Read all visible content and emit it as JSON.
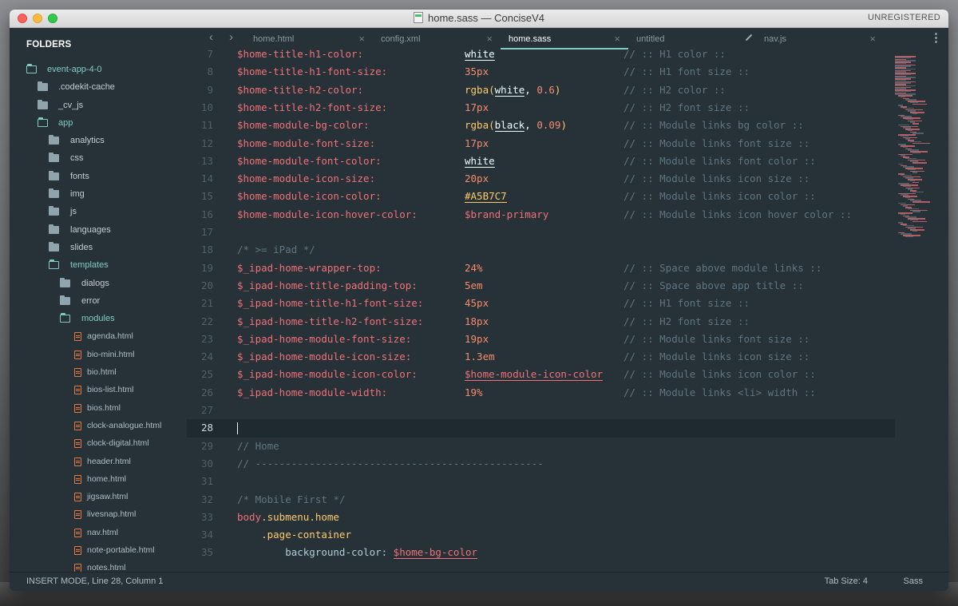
{
  "window": {
    "title": "home.sass — ConciseV4",
    "registration": "UNREGISTERED"
  },
  "sidebar": {
    "header": "FOLDERS",
    "items": [
      {
        "label": "event-app-4-0",
        "type": "folder",
        "open": true,
        "depth": 0
      },
      {
        "label": ".codekit-cache",
        "type": "folder",
        "open": false,
        "depth": 1
      },
      {
        "label": "_cv_js",
        "type": "folder",
        "open": false,
        "depth": 1
      },
      {
        "label": "app",
        "type": "folder",
        "open": true,
        "depth": 1
      },
      {
        "label": "analytics",
        "type": "folder",
        "open": false,
        "depth": 2
      },
      {
        "label": "css",
        "type": "folder",
        "open": false,
        "depth": 2
      },
      {
        "label": "fonts",
        "type": "folder",
        "open": false,
        "depth": 2
      },
      {
        "label": "img",
        "type": "folder",
        "open": false,
        "depth": 2
      },
      {
        "label": "js",
        "type": "folder",
        "open": false,
        "depth": 2
      },
      {
        "label": "languages",
        "type": "folder",
        "open": false,
        "depth": 2
      },
      {
        "label": "slides",
        "type": "folder",
        "open": false,
        "depth": 2
      },
      {
        "label": "templates",
        "type": "folder",
        "open": true,
        "depth": 2
      },
      {
        "label": "dialogs",
        "type": "folder",
        "open": false,
        "depth": 3
      },
      {
        "label": "error",
        "type": "folder",
        "open": false,
        "depth": 3
      },
      {
        "label": "modules",
        "type": "folder",
        "open": true,
        "depth": 3
      },
      {
        "label": "agenda.html",
        "type": "file",
        "depth": 4
      },
      {
        "label": "bio-mini.html",
        "type": "file",
        "depth": 4
      },
      {
        "label": "bio.html",
        "type": "file",
        "depth": 4
      },
      {
        "label": "bios-list.html",
        "type": "file",
        "depth": 4
      },
      {
        "label": "bios.html",
        "type": "file",
        "depth": 4
      },
      {
        "label": "clock-analogue.html",
        "type": "file",
        "depth": 4
      },
      {
        "label": "clock-digital.html",
        "type": "file",
        "depth": 4
      },
      {
        "label": "header.html",
        "type": "file",
        "depth": 4
      },
      {
        "label": "home.html",
        "type": "file",
        "depth": 4
      },
      {
        "label": "jigsaw.html",
        "type": "file",
        "depth": 4
      },
      {
        "label": "livesnap.html",
        "type": "file",
        "depth": 4
      },
      {
        "label": "nav.html",
        "type": "file",
        "depth": 4
      },
      {
        "label": "note-portable.html",
        "type": "file",
        "depth": 4
      },
      {
        "label": "notes.html",
        "type": "file",
        "depth": 4
      }
    ]
  },
  "tabs": [
    {
      "label": "home.html",
      "active": false,
      "close": "×"
    },
    {
      "label": "config.xml",
      "active": false,
      "close": "×"
    },
    {
      "label": "home.sass",
      "active": true,
      "close": "×"
    },
    {
      "label": "untitled",
      "active": false,
      "modified": true
    },
    {
      "label": "nav.js",
      "active": false,
      "close": "×"
    }
  ],
  "editor": {
    "lines": [
      {
        "n": "7",
        "code": "$home-title-h1-color:",
        "val": "white",
        "vt": "white",
        "cmt": "// :: H1 color ::"
      },
      {
        "n": "8",
        "code": "$home-title-h1-font-size:",
        "val": "35px",
        "vt": "num",
        "cmt": "// :: H1 font size ::"
      },
      {
        "n": "9",
        "code": "$home-title-h2-color:",
        "val": "rgba(white, 0.6)",
        "vt": "rgba",
        "rgbaArg": "white",
        "rgbaNum": "0.6",
        "cmt": "// :: H2 color ::"
      },
      {
        "n": "10",
        "code": "$home-title-h2-font-size:",
        "val": "17px",
        "vt": "num",
        "cmt": "// :: H2 font size ::"
      },
      {
        "n": "11",
        "code": "$home-module-bg-color:",
        "val": "rgba(black, 0.09)",
        "vt": "rgba",
        "rgbaArg": "black",
        "rgbaNum": "0.09",
        "cmt": "// :: Module links bg color ::"
      },
      {
        "n": "12",
        "code": "$home-module-font-size:",
        "val": "17px",
        "vt": "num",
        "cmt": "// :: Module links font size ::"
      },
      {
        "n": "13",
        "code": "$home-module-font-color:",
        "val": "white",
        "vt": "white",
        "cmt": "// :: Module links font color ::"
      },
      {
        "n": "14",
        "code": "$home-module-icon-size:",
        "val": "20px",
        "vt": "num",
        "cmt": "// :: Module links icon size ::"
      },
      {
        "n": "15",
        "code": "$home-module-icon-color:",
        "val": "#A5B7C7",
        "vt": "hex",
        "cmt": "// :: Module links icon color ::"
      },
      {
        "n": "16",
        "code": "$home-module-icon-hover-color:",
        "val": "$brand-primary",
        "vt": "var",
        "cmt": "// :: Module links icon hover color ::"
      },
      {
        "n": "17",
        "code": "",
        "val": "",
        "vt": "",
        "cmt": ""
      },
      {
        "n": "18",
        "code": "/* >= iPad */",
        "ct": "comment",
        "val": "",
        "vt": "",
        "cmt": ""
      },
      {
        "n": "19",
        "code": "$_ipad-home-wrapper-top:",
        "val": "24%",
        "vt": "num",
        "cmt": "// :: Space above module links ::"
      },
      {
        "n": "20",
        "code": "$_ipad-home-title-padding-top:",
        "val": "5em",
        "vt": "num",
        "cmt": "// :: Space above app title ::"
      },
      {
        "n": "21",
        "code": "$_ipad-home-title-h1-font-size:",
        "val": "45px",
        "vt": "num",
        "cmt": "// :: H1 font size ::"
      },
      {
        "n": "22",
        "code": "$_ipad-home-title-h2-font-size:",
        "val": "18px",
        "vt": "num",
        "cmt": "// :: H2 font size ::"
      },
      {
        "n": "23",
        "code": "$_ipad-home-module-font-size:",
        "val": "19px",
        "vt": "num",
        "cmt": "// :: Module links font size ::"
      },
      {
        "n": "24",
        "code": "$_ipad-home-module-icon-size:",
        "val": "1.3em",
        "vt": "num",
        "cmt": "// :: Module links icon size ::"
      },
      {
        "n": "25",
        "code": "$_ipad-home-module-icon-color:",
        "val": "$home-module-icon-color",
        "vt": "varu",
        "cmt": "// :: Module links icon color ::"
      },
      {
        "n": "26",
        "code": "$_ipad-home-module-width:",
        "val": "19%",
        "vt": "num",
        "cmt": "// :: Module links <li> width ::"
      },
      {
        "n": "27",
        "code": "",
        "val": "",
        "vt": "",
        "cmt": ""
      },
      {
        "n": "28",
        "code": "",
        "val": "",
        "vt": "",
        "cmt": "",
        "current": true
      },
      {
        "n": "29",
        "code": "// Home",
        "ct": "comment",
        "val": "",
        "vt": "",
        "cmt": ""
      },
      {
        "n": "30",
        "code": "// ------------------------------------------------",
        "ct": "comment",
        "val": "",
        "vt": "",
        "cmt": ""
      },
      {
        "n": "31",
        "code": "",
        "val": "",
        "vt": "",
        "cmt": ""
      },
      {
        "n": "32",
        "code": "/* Mobile First */",
        "ct": "comment",
        "val": "",
        "vt": "",
        "cmt": ""
      },
      {
        "n": "33",
        "code": "",
        "ct": "selector",
        "tag": "body",
        "cls": ".submenu.home",
        "val": "",
        "vt": "",
        "cmt": ""
      },
      {
        "n": "34",
        "code": "    .page-container",
        "ct": "class",
        "val": "",
        "vt": "",
        "cmt": ""
      },
      {
        "n": "35",
        "code": "",
        "ct": "prop",
        "prop": "        background-color: ",
        "propVal": "$home-bg-color",
        "val": "",
        "vt": "",
        "cmt": ""
      }
    ]
  },
  "status": {
    "left": "INSERT MODE, Line 28, Column 1",
    "tab_size": "Tab Size: 4",
    "syntax": "Sass"
  },
  "colors": {
    "background": "#263238",
    "variable": "#f07178",
    "number": "#f78c6c",
    "accent": "#80cbc4",
    "comment": "#5f7580"
  }
}
